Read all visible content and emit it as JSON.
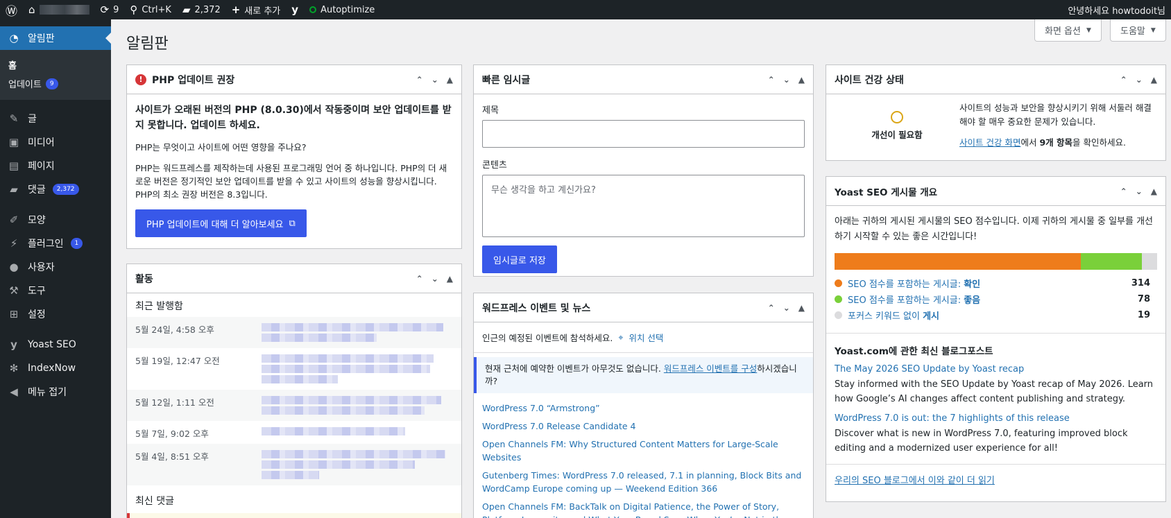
{
  "adminbar": {
    "updates_count": "9",
    "search_shortcut": "Ctrl+K",
    "comments_count": "2,372",
    "new_label": "새로 추가",
    "autoptimize_label": "Autoptimize",
    "greeting": "안녕하세요 howtodoit님"
  },
  "header": {
    "page_title": "알림판",
    "screen_options": "화면 옵션",
    "help": "도움말"
  },
  "sidebar": {
    "dashboard": "알림판",
    "home": "홈",
    "updates": "업데이트",
    "updates_badge": "9",
    "posts": "글",
    "media": "미디어",
    "pages": "페이지",
    "comments": "댓글",
    "comments_badge": "2,372",
    "appearance": "모양",
    "plugins": "플러그인",
    "plugins_badge": "1",
    "users": "사용자",
    "tools": "도구",
    "settings": "설정",
    "yoast": "Yoast SEO",
    "indexnow": "IndexNow",
    "collapse": "메뉴 접기"
  },
  "php_box": {
    "title": "PHP 업데이트 권장",
    "headline": "사이트가 오래된 버전의 PHP (8.0.30)에서 작동중이며 보안 업데이트를 받지 못합니다. 업데이트 하세요.",
    "question": "PHP는 무엇이고 사이트에 어떤 영향을 주나요?",
    "description": "PHP는 워드프레스를 제작하는데 사용된 프로그래밍 언어 중 하나입니다. PHP의 더 새로운 버전은 정기적인 보안 업데이트를 받을 수 있고 사이트의 성능을 향상시킵니다. PHP의 최소 권장 버전은 8.3입니다.",
    "button": "PHP 업데이트에 대해 더 알아보세요"
  },
  "activity_box": {
    "title": "활동",
    "recently_published": "최근 발행함",
    "dates": [
      "5월 24일, 4:58 오후",
      "5월 19일, 12:47 오전",
      "5월 12일, 1:11 오전",
      "5월 7일, 9:02 오후",
      "5월 4일, 8:51 오후"
    ],
    "recent_comments": "최신 댓글"
  },
  "quickdraft_box": {
    "title": "빠른 임시글",
    "title_label": "제목",
    "content_label": "콘텐츠",
    "content_placeholder": "무슨 생각을 하고 계신가요?",
    "save_button": "임시글로 저장"
  },
  "events_box": {
    "title": "워드프레스 이벤트 및 뉴스",
    "intro": "인근의 예정된 이벤트에 참석하세요.",
    "location_link": "위치 선택",
    "notice_before": "현재 근처에 예약한 이벤트가 아무것도 없습니다. ",
    "notice_link": "워드프레스 이벤트를 구성",
    "notice_after": "하시겠습니까?",
    "news": [
      "WordPress 7.0 “Armstrong”",
      "WordPress 7.0 Release Candidate 4",
      "Open Channels FM: Why Structured Content Matters for Large-Scale Websites",
      "Gutenberg Times: WordPress 7.0 released, 7.1 in planning, Block Bits and WordCamp Europe coming up — Weekend Edition 366",
      "Open Channels FM: BackTalk on Digital Patience, the Power of Story, Platform Longevity, and What Your Brand Says When You’re Not in the Room"
    ]
  },
  "health_box": {
    "title": "사이트 건강 상태",
    "status": "개선이 필요함",
    "description": "사이트의 성능과 보안을 향상시키기 위해 서둘러 해결해야 할 매우 중요한 문제가 있습니다.",
    "link": "사이트 건강 화면",
    "after_link": "에서 ",
    "items_count": "9개 항목",
    "tail": "을 확인하세요."
  },
  "yoast_box": {
    "title": "Yoast SEO 게시물 개요",
    "intro": "아래는 귀하의 게시된 게시물의 SEO 점수입니다. 이제 귀하의 게시물 중 일부를 개선하기 시작할 수 있는 좋은 시간입니다!",
    "scores": [
      {
        "label_prefix": "SEO 점수를 포함하는 게시글: ",
        "label_strong": "확인",
        "count": 314,
        "color": "#ee7c1b"
      },
      {
        "label_prefix": "SEO 점수를 포함하는 게시글: ",
        "label_strong": "좋음",
        "count": 78,
        "color": "#7ad03a"
      },
      {
        "label_prefix": "포커스 키워드 없이 ",
        "label_strong": "게시",
        "count": 19,
        "color": "#dcdcde"
      }
    ],
    "blog_heading": "Yoast.com에 관한 최신 블로그포스트",
    "posts": [
      {
        "title": "The May 2026 SEO Update by Yoast recap",
        "desc": "Stay informed with the SEO Update by Yoast recap of May 2026. Learn how Google’s AI changes affect content publishing and strategy."
      },
      {
        "title": "WordPress 7.0 is out: the 7 highlights of this release",
        "desc": "Discover what is new in WordPress 7.0, featuring improved block editing and a modernized user experience for all!"
      }
    ],
    "more_link": "우리의 SEO 블로그에서 이와 같이 더 읽기"
  },
  "colors": {
    "accent": "#3858e9",
    "sidebar_bg": "#1d2327",
    "sidebar_current": "#2271b1",
    "link": "#2271b1"
  }
}
